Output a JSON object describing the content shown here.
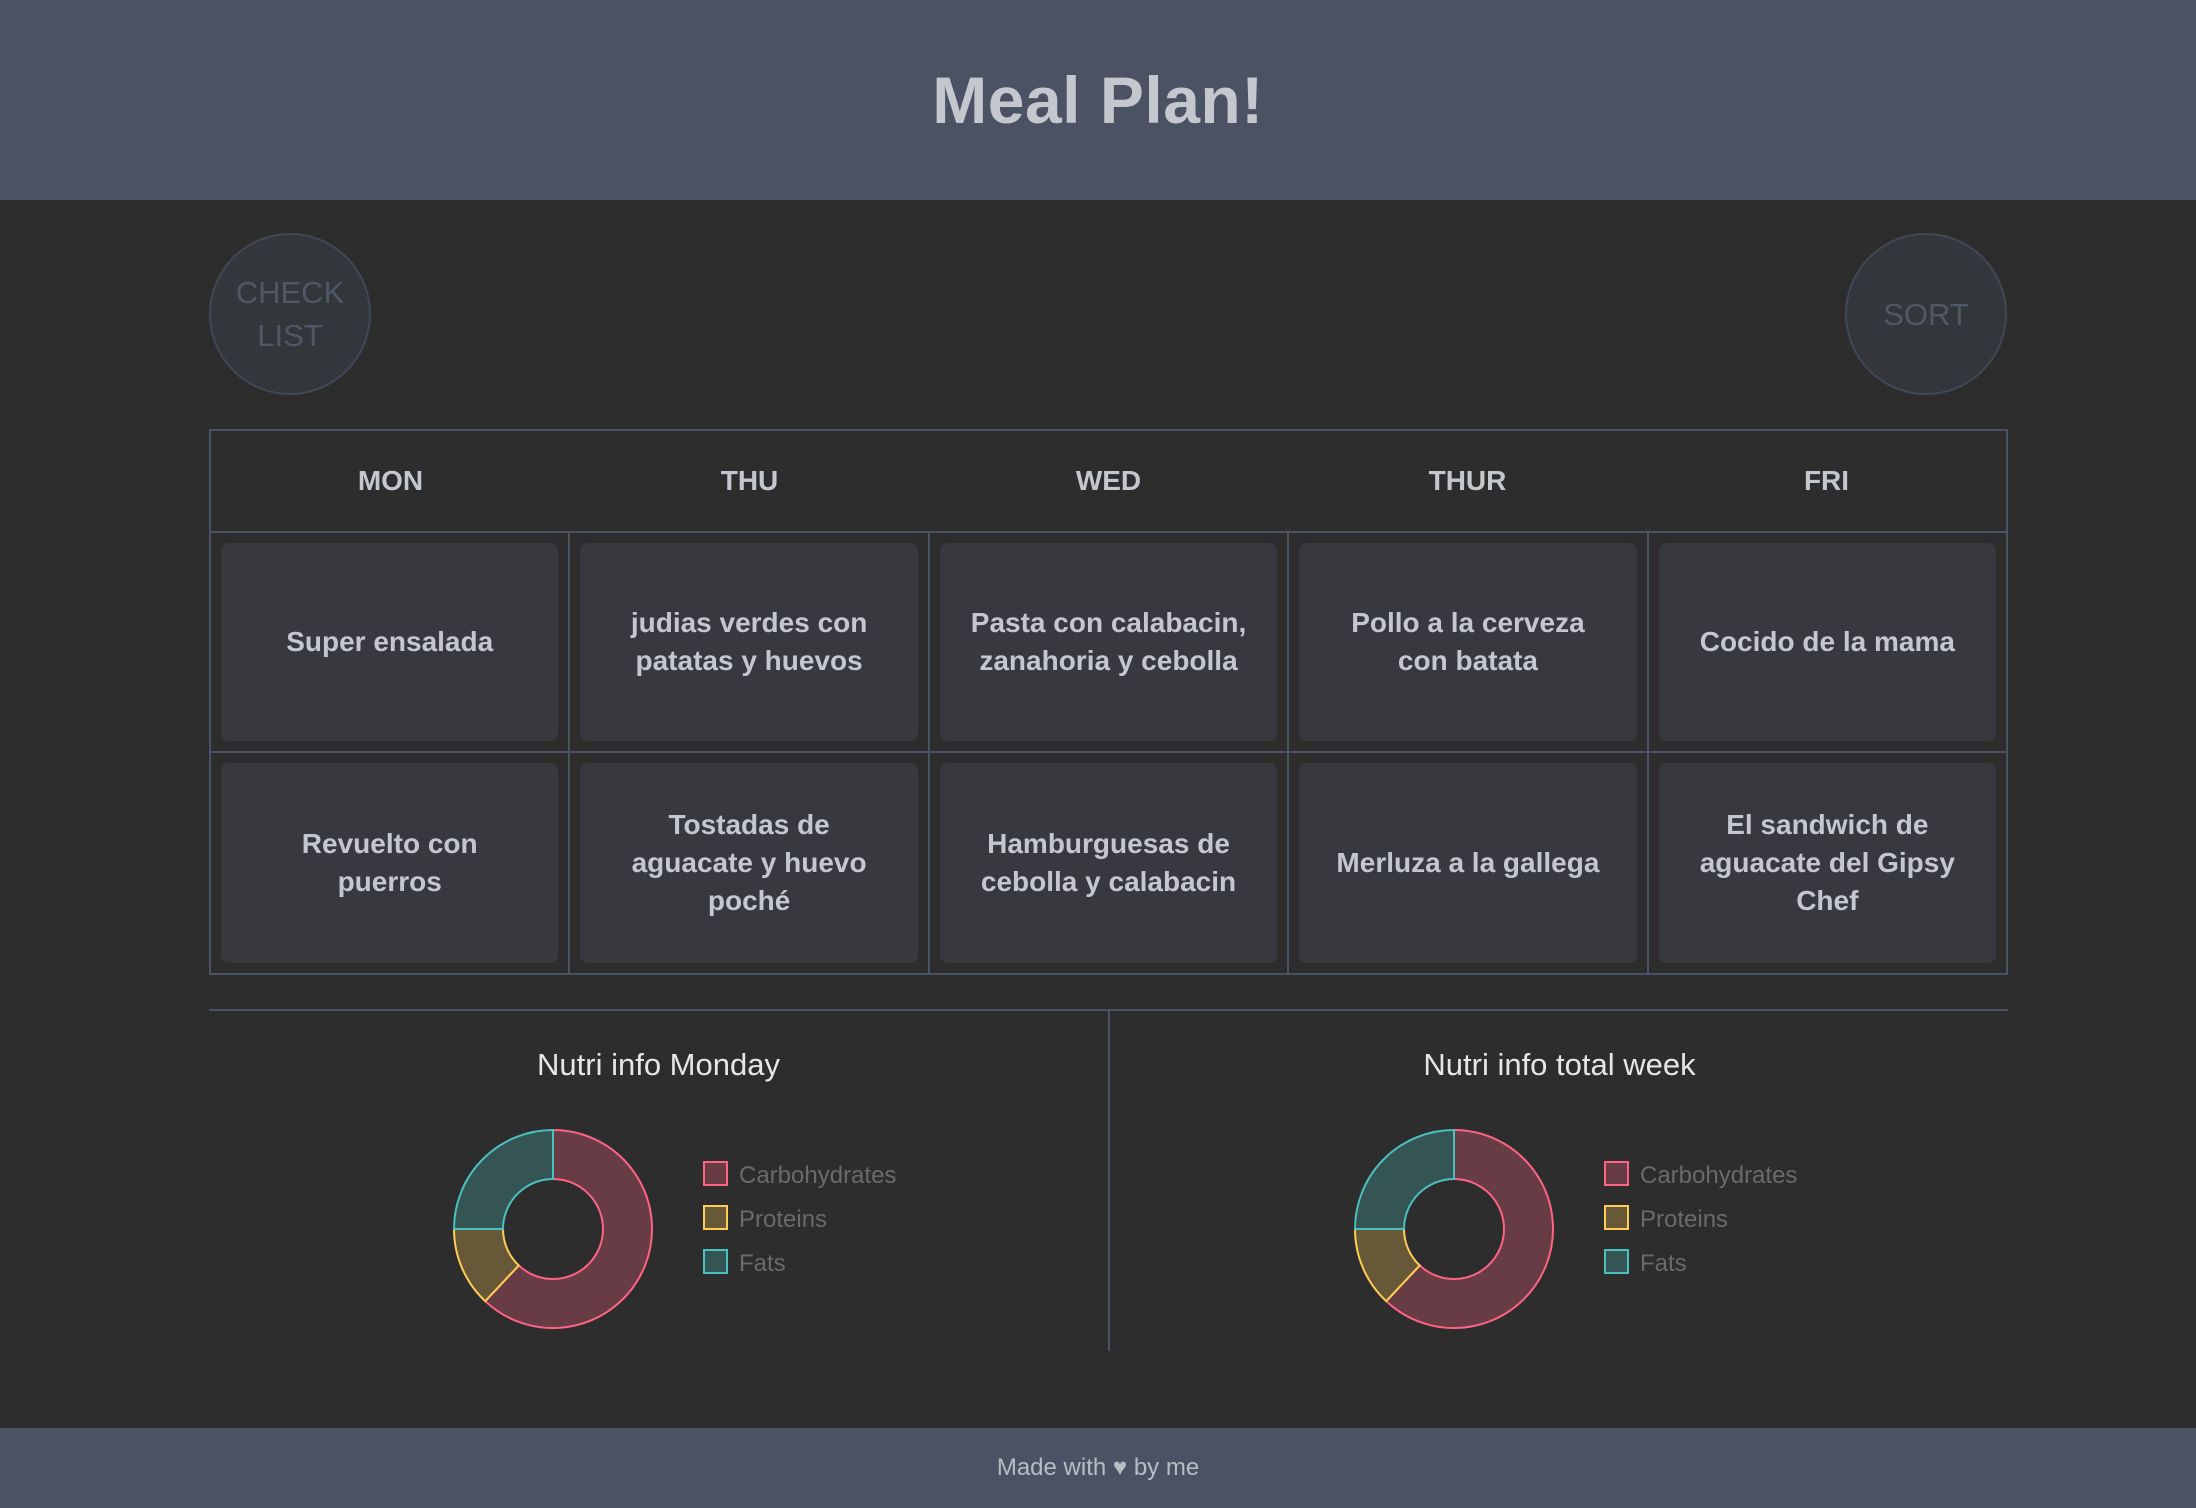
{
  "header": {
    "title": "Meal Plan!"
  },
  "buttons": {
    "check_list": "CHECK LIST",
    "sort": "SORT"
  },
  "table": {
    "days": [
      "MON",
      "THU",
      "WED",
      "THUR",
      "FRI"
    ],
    "rows": [
      [
        "Super ensalada",
        "judias verdes con patatas y huevos",
        "Pasta con calabacin, zanahoria y cebolla",
        "Pollo a la cerveza con batata",
        "Cocido de la mama"
      ],
      [
        "Revuelto con puerros",
        "Tostadas de aguacate y huevo poché",
        "Hamburguesas de cebolla y calabacin",
        "Merluza a la gallega",
        "El sandwich de aguacate del Gipsy Chef"
      ]
    ]
  },
  "chart_data": [
    {
      "type": "pie",
      "title": "Nutri info Monday",
      "categories": [
        "Carbohydrates",
        "Proteins",
        "Fats"
      ],
      "values": [
        62,
        13,
        25
      ],
      "colors": [
        "#ff6384",
        "#ffcd56",
        "#4bc0c0"
      ],
      "legend": "right"
    },
    {
      "type": "pie",
      "title": "Nutri info total week",
      "categories": [
        "Carbohydrates",
        "Proteins",
        "Fats"
      ],
      "values": [
        62,
        13,
        25
      ],
      "colors": [
        "#ff6384",
        "#ffcd56",
        "#4bc0c0"
      ],
      "legend": "right"
    }
  ],
  "footer": {
    "before": "Made with",
    "heart": "♥",
    "after": "by me"
  }
}
